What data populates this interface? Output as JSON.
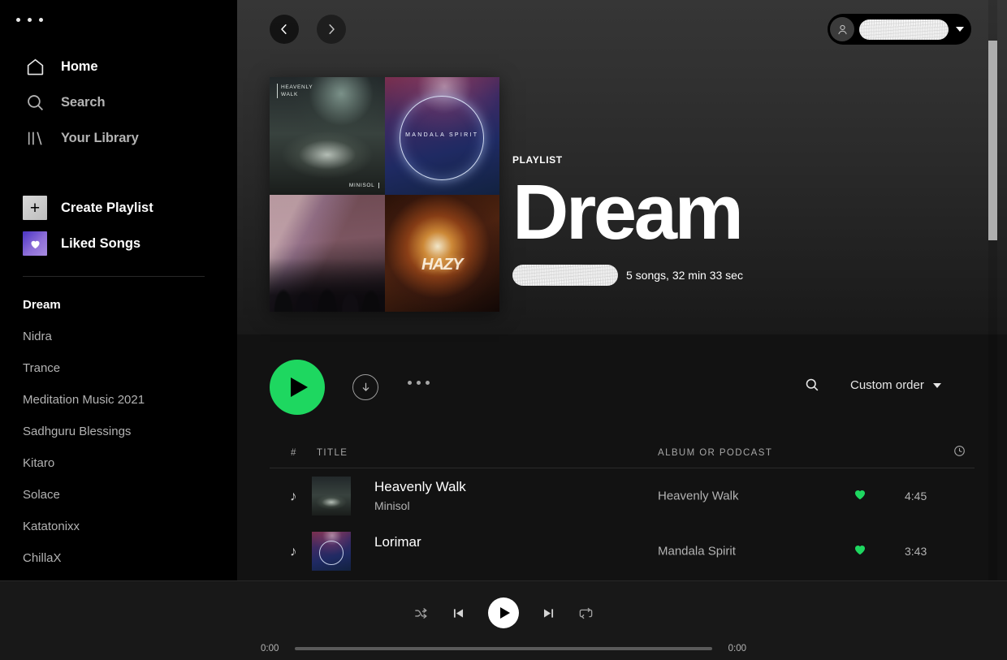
{
  "window": {
    "dots_icon": "window-menu-dots"
  },
  "sidebar": {
    "nav": [
      {
        "label": "Home",
        "icon": "home-icon",
        "active": true
      },
      {
        "label": "Search",
        "icon": "search-icon",
        "active": false
      },
      {
        "label": "Your Library",
        "icon": "library-icon",
        "active": false
      }
    ],
    "tiles": [
      {
        "label": "Create Playlist",
        "icon": "plus-icon"
      },
      {
        "label": "Liked Songs",
        "icon": "heart-icon"
      }
    ],
    "playlists": [
      {
        "label": "Dream",
        "active": true
      },
      {
        "label": "Nidra",
        "active": false
      },
      {
        "label": "Trance",
        "active": false
      },
      {
        "label": "Meditation Music 2021",
        "active": false
      },
      {
        "label": "Sadhguru Blessings",
        "active": false
      },
      {
        "label": "Kitaro",
        "active": false
      },
      {
        "label": "Solace",
        "active": false
      },
      {
        "label": "Katatonixx",
        "active": false
      },
      {
        "label": "ChillaX",
        "active": false
      }
    ]
  },
  "topbar": {
    "back_icon": "chevron-left-icon",
    "forward_icon": "chevron-right-icon",
    "profile": {
      "avatar_icon": "person-icon",
      "name": "",
      "name_redacted": true,
      "caret_icon": "chevron-down-icon"
    }
  },
  "hero": {
    "kicker": "PLAYLIST",
    "title": "Dream",
    "owner": "",
    "owner_redacted": true,
    "meta": "5 songs, 32 min 33 sec",
    "cover": [
      {
        "title": "HEAVENLY\nWALK",
        "artist": "MINISOL",
        "name": "cover-heavenly-walk"
      },
      {
        "title": "MANDALA SPIRIT",
        "artist": "",
        "name": "cover-mandala-spirit"
      },
      {
        "title": "",
        "artist": "",
        "name": "cover-concert-crowd"
      },
      {
        "title": "HAZY",
        "artist": "",
        "name": "cover-hazy"
      }
    ]
  },
  "actions": {
    "play_icon": "play-icon",
    "download_icon": "download-arrow-icon",
    "more_icon": "more-dots-icon",
    "search_icon": "search-icon",
    "sort_label": "Custom order",
    "sort_caret_icon": "chevron-down-icon"
  },
  "table": {
    "columns": {
      "index": "#",
      "title": "TITLE",
      "album": "ALBUM OR PODCAST",
      "duration_icon": "clock-icon"
    },
    "rows": [
      {
        "index_icon": "music-note-icon",
        "title": "Heavenly Walk",
        "artist": "Minisol",
        "album": "Heavenly Walk",
        "liked": true,
        "like_icon": "heart-filled-icon",
        "duration": "4:45"
      },
      {
        "index_icon": "music-note-icon",
        "title": "Lorimar",
        "artist": "",
        "album": "Mandala Spirit",
        "liked": true,
        "like_icon": "heart-filled-icon",
        "duration": "3:43"
      }
    ]
  },
  "player": {
    "shuffle_icon": "shuffle-icon",
    "previous_icon": "skip-previous-icon",
    "play_icon": "play-icon",
    "next_icon": "skip-next-icon",
    "repeat_icon": "repeat-icon",
    "elapsed": "0:00",
    "total": "0:00"
  },
  "colors": {
    "accent_green": "#1ed760",
    "like_green": "#1ed760",
    "sidebar_bg": "#000000",
    "main_bg": "#121212",
    "player_bg": "#181818",
    "text_muted": "#b3b3b3"
  }
}
